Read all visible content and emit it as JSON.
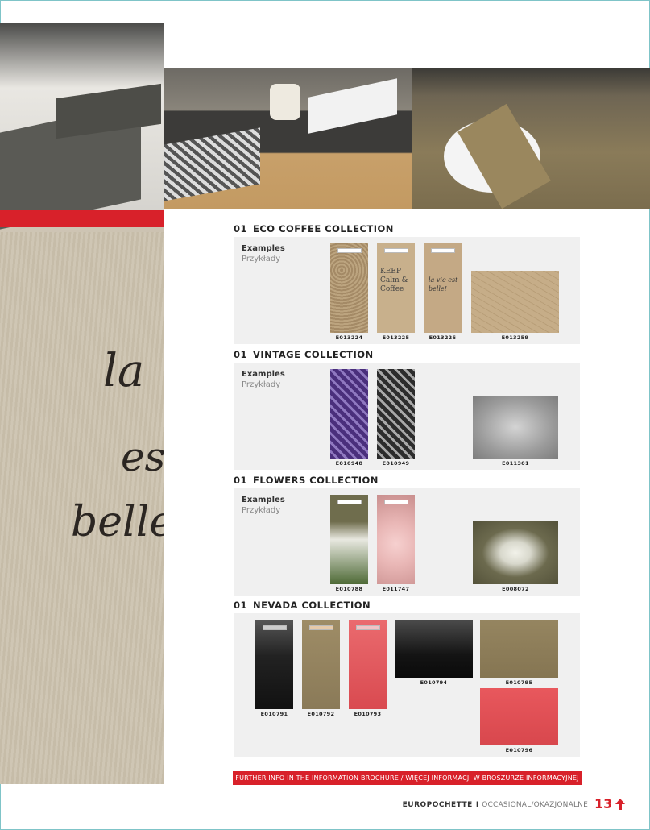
{
  "sections": [
    {
      "num": "01",
      "title": "ECO COFFEE COLLECTION",
      "examples_en": "Examples",
      "examples_pl": "Przykłady",
      "products": [
        {
          "code": "E013224",
          "color": "#b49a77",
          "text": ""
        },
        {
          "code": "E013225",
          "color": "#c8b08c",
          "text": "KEEP Calm & Coffee"
        },
        {
          "code": "E013226",
          "color": "#c4a985",
          "text": "la vie est belle!"
        },
        {
          "code": "E013259",
          "color": "#c6ad88",
          "text": ""
        }
      ]
    },
    {
      "num": "01",
      "title": "VINTAGE COLLECTION",
      "examples_en": "Examples",
      "examples_pl": "Przykłady",
      "products": [
        {
          "code": "E010948",
          "color": "#5b3d8e"
        },
        {
          "code": "E010949",
          "color": "#6f6f6f"
        },
        {
          "code": "E011301",
          "color": "#9c9c9c"
        }
      ]
    },
    {
      "num": "01",
      "title": "FLOWERS COLLECTION",
      "examples_en": "Examples",
      "examples_pl": "Przykłady",
      "products": [
        {
          "code": "E010788",
          "color": "#6f6d4d"
        },
        {
          "code": "E011747",
          "color": "#e9b7b6"
        },
        {
          "code": "E008072",
          "color": "#6c6a4e"
        }
      ]
    },
    {
      "num": "01",
      "title": "NEVADA COLLECTION",
      "products": [
        {
          "code": "E010791",
          "color": "#222222"
        },
        {
          "code": "E010792",
          "color": "#8a7a58"
        },
        {
          "code": "E010793",
          "color": "#e2545a"
        },
        {
          "code": "E010794",
          "color": "#1c1c1c"
        },
        {
          "code": "E010795",
          "color": "#8a7a58"
        },
        {
          "code": "E010796",
          "color": "#e2545a"
        }
      ]
    }
  ],
  "photo_script": {
    "line1": "la",
    "line2": "es",
    "line3": "belle"
  },
  "footer": {
    "info": "FURTHER INFO IN THE INFORMATION BROCHURE  /  WIĘCEJ INFORMACJI W BROSZURZE INFORMACYJNEJ",
    "brand": "EUROPOCHETTE",
    "separator": "I",
    "category": "OCCASIONAL/OKAZJONALNE",
    "page": "13"
  },
  "colors": {
    "accent": "#d8212a",
    "frame": "#7fc4c8"
  },
  "icons": {
    "page_arrow": "up-arrow-icon"
  }
}
